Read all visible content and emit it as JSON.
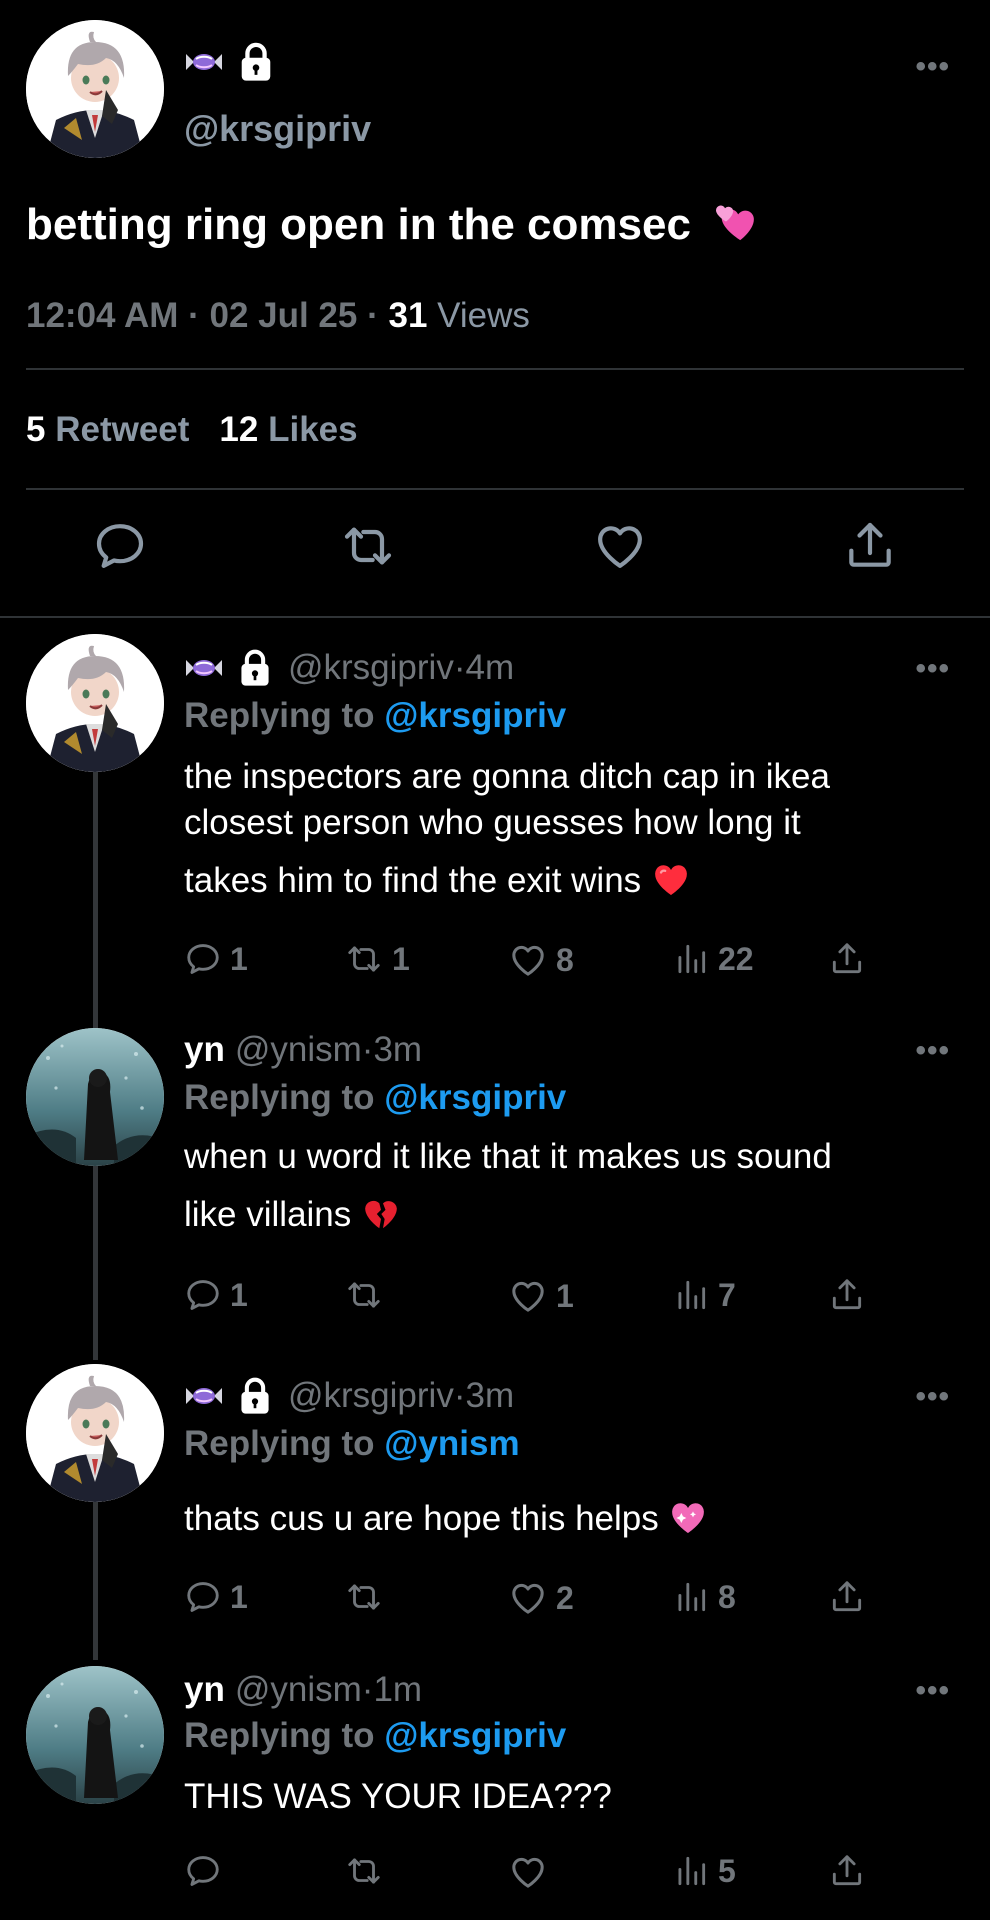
{
  "main": {
    "handle": "@krsgipriv",
    "text": "betting ring open in the comsec",
    "time": "12:04 AM",
    "dot": " · ",
    "date": "02 Jul 25",
    "views_count": "31",
    "views_label": "Views",
    "retweet_count": "5",
    "retweet_label": "Retweet",
    "likes_count": "12",
    "likes_label": "Likes",
    "more": "•••"
  },
  "replies": [
    {
      "name": "",
      "handle": "@krsgipriv",
      "time": "4m",
      "replying_prefix": "Replying to ",
      "replying_to": "@krsgipriv",
      "lines": [
        "the inspectors are gonna ditch cap in ikea",
        "closest person who guesses how long it",
        "takes him to find the exit wins"
      ],
      "emoji": "red-heart",
      "counts": {
        "reply": "1",
        "retweet": "1",
        "like": "8",
        "views": "22"
      }
    },
    {
      "name": "yn",
      "handle": "@ynism",
      "time": "3m",
      "replying_prefix": "Replying to ",
      "replying_to": "@krsgipriv",
      "lines": [
        "when u word it like that it makes us sound",
        "like villains"
      ],
      "emoji": "broken-heart",
      "counts": {
        "reply": "1",
        "retweet": "",
        "like": "1",
        "views": "7"
      }
    },
    {
      "name": "",
      "handle": "@krsgipriv",
      "time": "3m",
      "replying_prefix": "Replying to ",
      "replying_to": "@ynism",
      "lines": [
        "thats cus u are hope this helps"
      ],
      "emoji": "sparkling-heart",
      "counts": {
        "reply": "1",
        "retweet": "",
        "like": "2",
        "views": "8"
      }
    },
    {
      "name": "yn",
      "handle": "@ynism",
      "time": "1m",
      "replying_prefix": "Replying to ",
      "replying_to": "@krsgipriv",
      "lines": [
        "THIS WAS YOUR IDEA???"
      ],
      "emoji": "",
      "counts": {
        "reply": "",
        "retweet": "",
        "like": "",
        "views": "5"
      }
    }
  ],
  "sep": " · ",
  "colors": {
    "link": "#1d9bf0",
    "muted": "#71767b",
    "background": "#000000"
  }
}
